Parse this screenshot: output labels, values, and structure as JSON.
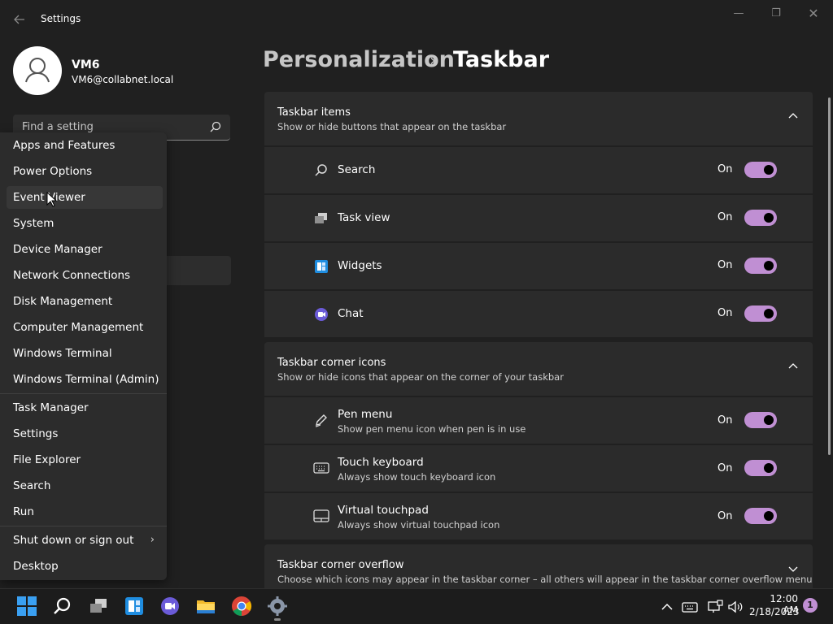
{
  "window": {
    "title": "Settings",
    "controls": {
      "minimize": "—",
      "maximize": "❐",
      "close": "✕"
    }
  },
  "user": {
    "name": "VM6",
    "email": "VM6@collabnet.local"
  },
  "search": {
    "placeholder": "Find a setting"
  },
  "breadcrumb": {
    "parent": "Personalization",
    "separator": "›",
    "current": "Taskbar"
  },
  "sections": [
    {
      "title": "Taskbar items",
      "subtitle": "Show or hide buttons that appear on the taskbar",
      "expanded": true,
      "items": [
        {
          "label": "Search",
          "desc": "",
          "state": "On",
          "icon": "search-icon"
        },
        {
          "label": "Task view",
          "desc": "",
          "state": "On",
          "icon": "task-view-icon"
        },
        {
          "label": "Widgets",
          "desc": "",
          "state": "On",
          "icon": "widgets-icon"
        },
        {
          "label": "Chat",
          "desc": "",
          "state": "On",
          "icon": "chat-icon"
        }
      ]
    },
    {
      "title": "Taskbar corner icons",
      "subtitle": "Show or hide icons that appear on the corner of your taskbar",
      "expanded": true,
      "items": [
        {
          "label": "Pen menu",
          "desc": "Show pen menu icon when pen is in use",
          "state": "On",
          "icon": "pen-icon"
        },
        {
          "label": "Touch keyboard",
          "desc": "Always show touch keyboard icon",
          "state": "On",
          "icon": "keyboard-icon"
        },
        {
          "label": "Virtual touchpad",
          "desc": "Always show virtual touchpad icon",
          "state": "On",
          "icon": "touchpad-icon"
        }
      ]
    },
    {
      "title": "Taskbar corner overflow",
      "subtitle": "Choose which icons may appear in the taskbar corner – all others will appear in the taskbar corner overflow menu",
      "expanded": false,
      "items": []
    }
  ],
  "context_menu": {
    "group1": [
      "Apps and Features",
      "Power Options",
      "Event Viewer",
      "System",
      "Device Manager",
      "Network Connections",
      "Disk Management",
      "Computer Management",
      "Windows Terminal",
      "Windows Terminal (Admin)"
    ],
    "group2": [
      "Task Manager",
      "Settings",
      "File Explorer",
      "Search",
      "Run"
    ],
    "group3": [
      "Shut down or sign out",
      "Desktop"
    ],
    "hovered": "Event Viewer",
    "submenu_arrow": "›"
  },
  "taskbar": {
    "apps": [
      "start-icon",
      "search-icon",
      "task-view-icon",
      "widgets-icon",
      "chat-icon",
      "file-explorer-icon",
      "chrome-icon",
      "settings-icon"
    ],
    "tray": [
      "chevron-up-icon",
      "keyboard-icon",
      "network-icon",
      "volume-icon"
    ],
    "time": "12:00 AM",
    "date": "2/18/2023",
    "notifications": "1"
  },
  "colors": {
    "accent": "#c08fd3",
    "background": "#202020",
    "card": "#2b2b2b"
  }
}
